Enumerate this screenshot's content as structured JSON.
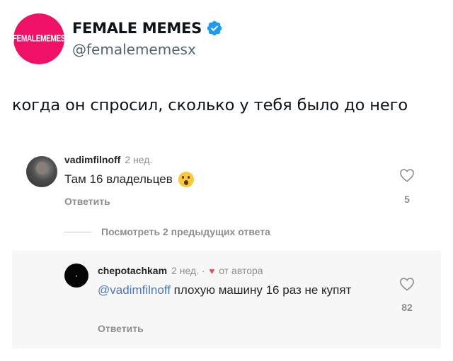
{
  "tweet": {
    "avatar_text": "FEMALEMEMES",
    "display_name": "FEMALE MEMES",
    "handle": "@femalememesx",
    "text": "когда он спросил, сколько у тебя было до него",
    "accent_color": "#ee1166",
    "verified_color": "#1d9bf0"
  },
  "comment1": {
    "username": "vadimfilnoff",
    "time": "2 нед.",
    "text": "Там 16 владельцев",
    "emoji": "hushed-face-emoji",
    "reply_label": "Ответить",
    "likes": "5"
  },
  "view_more": {
    "label": "Посмотреть 2 предыдущих ответа"
  },
  "comment2": {
    "username": "chepotachkam",
    "time": "2 нед. ·",
    "author_badge": "от автора",
    "mention": "@vadimfilnoff",
    "text": " плохую машину 16 раз не купят",
    "reply_label": "Ответить",
    "likes": "82"
  }
}
